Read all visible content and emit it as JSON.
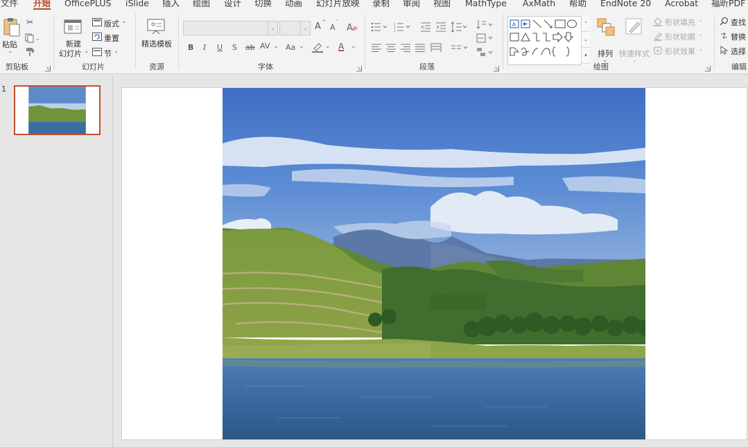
{
  "menu": {
    "tabs": [
      {
        "label": "文件"
      },
      {
        "label": "开始",
        "active": true
      },
      {
        "label": "OfficePLUS"
      },
      {
        "label": "iSlide"
      },
      {
        "label": "插入"
      },
      {
        "label": "绘图"
      },
      {
        "label": "设计"
      },
      {
        "label": "切换"
      },
      {
        "label": "动画"
      },
      {
        "label": "幻灯片放映"
      },
      {
        "label": "录制"
      },
      {
        "label": "审阅"
      },
      {
        "label": "视图"
      },
      {
        "label": "MathType"
      },
      {
        "label": "AxMath"
      },
      {
        "label": "帮助"
      },
      {
        "label": "EndNote 20"
      },
      {
        "label": "Acrobat"
      },
      {
        "label": "福昕PDF"
      }
    ]
  },
  "ribbon": {
    "clipboard": {
      "label": "剪贴板",
      "paste": "粘贴"
    },
    "slides": {
      "label": "幻灯片",
      "new_slide_line1": "新建",
      "new_slide_line2": "幻灯片",
      "layout": "版式",
      "reset": "重置",
      "section": "节"
    },
    "resources": {
      "label": "资源",
      "templates": "精选模板"
    },
    "font": {
      "label": "字体",
      "grow": "A",
      "shrink": "A",
      "bold": "B",
      "italic": "I",
      "underline": "U",
      "shadow": "S",
      "strike": "ab",
      "spacing": "AV",
      "case": "Aa",
      "font_color": "A"
    },
    "paragraph": {
      "label": "段落"
    },
    "drawing": {
      "label": "绘图",
      "arrange": "排列",
      "quick_styles": "快速样式",
      "shape_fill": "形状填充",
      "shape_outline": "形状轮廓",
      "shape_effects": "形状效果"
    },
    "editing": {
      "label": "编辑",
      "find": "查找",
      "replace": "替换",
      "select": "选择"
    }
  },
  "slides_pane": {
    "slide_number": "1"
  },
  "colors": {
    "accent": "#b7472a",
    "ribbon_bg": "#f3f3f3",
    "workspace_bg": "#e6e6e6",
    "thumb_border": "#c1502e"
  }
}
